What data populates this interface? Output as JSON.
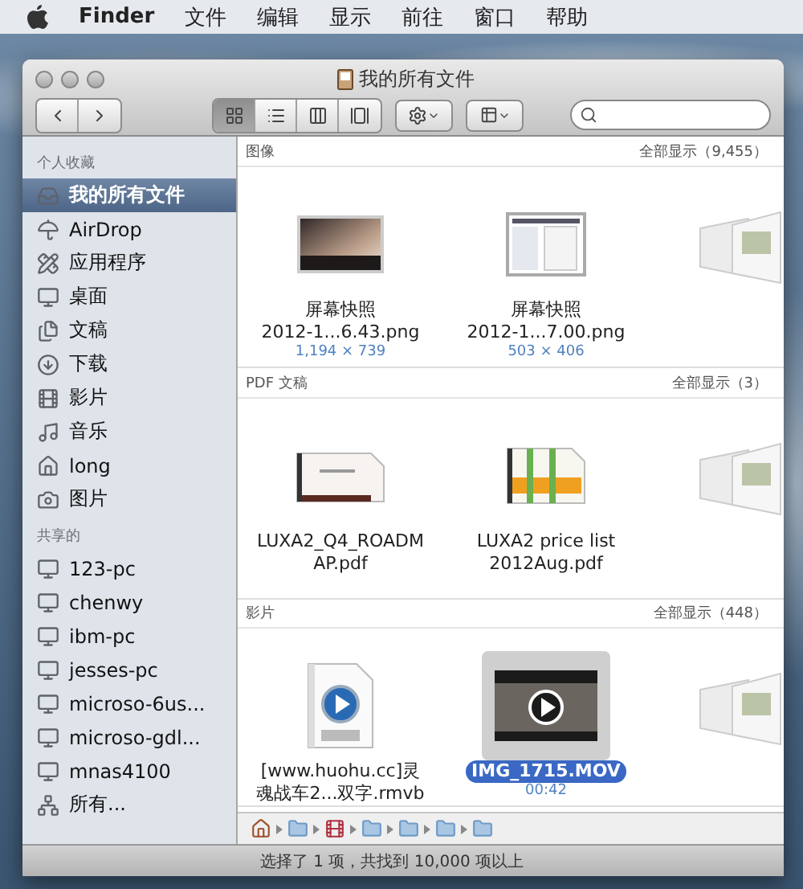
{
  "menubar": {
    "app": "Finder",
    "menus": [
      "文件",
      "编辑",
      "显示",
      "前往",
      "窗口",
      "帮助"
    ]
  },
  "window": {
    "title": "我的所有文件"
  },
  "toolbar": {
    "views": [
      {
        "kind": "icon",
        "selected": true
      },
      {
        "kind": "list",
        "selected": false
      },
      {
        "kind": "column",
        "selected": false
      },
      {
        "kind": "coverflow",
        "selected": false
      }
    ]
  },
  "sidebar": [
    {
      "title": "个人收藏",
      "items": [
        {
          "label": "我的所有文件",
          "kind": "all-files",
          "selected": true
        },
        {
          "label": "AirDrop",
          "kind": "airdrop",
          "selected": false
        },
        {
          "label": "应用程序",
          "kind": "apps",
          "selected": false
        },
        {
          "label": "桌面",
          "kind": "desktop",
          "selected": false
        },
        {
          "label": "文稿",
          "kind": "documents",
          "selected": false
        },
        {
          "label": "下载",
          "kind": "downloads",
          "selected": false
        },
        {
          "label": "影片",
          "kind": "movies",
          "selected": false
        },
        {
          "label": "音乐",
          "kind": "music",
          "selected": false
        },
        {
          "label": "long",
          "kind": "home",
          "selected": false
        },
        {
          "label": "图片",
          "kind": "pictures",
          "selected": false
        }
      ]
    },
    {
      "title": "共享的",
      "items": [
        {
          "label": "123-pc",
          "kind": "computer",
          "selected": false
        },
        {
          "label": "chenwy",
          "kind": "computer",
          "selected": false
        },
        {
          "label": "ibm-pc",
          "kind": "computer",
          "selected": false
        },
        {
          "label": "jesses-pc",
          "kind": "computer",
          "selected": false
        },
        {
          "label": "microso-6us...",
          "kind": "computer",
          "selected": false
        },
        {
          "label": "microso-gdl...",
          "kind": "computer",
          "selected": false
        },
        {
          "label": "mnas4100",
          "kind": "computer",
          "selected": false
        },
        {
          "label": "所有...",
          "kind": "network",
          "selected": false
        }
      ]
    }
  ],
  "sections": [
    {
      "title": "图像",
      "show_all": "全部显示（9,455）",
      "items": [
        {
          "kind": "photo",
          "name_lines": [
            "屏幕快照",
            "2012-1...6.43.png"
          ],
          "detail": "1,194 × 739",
          "selected": false
        },
        {
          "kind": "screenshot",
          "name_lines": [
            "屏幕快照",
            "2012-1...7.00.png"
          ],
          "detail": "503 × 406",
          "selected": false
        },
        {
          "kind": "stack"
        }
      ]
    },
    {
      "title": "PDF 文稿",
      "show_all": "全部显示（3）",
      "items": [
        {
          "kind": "pdf",
          "name_lines": [
            "LUXA2_Q4_ROADM",
            "AP.pdf"
          ],
          "selected": false
        },
        {
          "kind": "pdf-chart",
          "name_lines": [
            "LUXA2 price list",
            "2012Aug.pdf"
          ],
          "selected": false
        },
        {
          "kind": "stack"
        }
      ]
    },
    {
      "title": "影片",
      "show_all": "全部显示（448）",
      "items": [
        {
          "kind": "video-file",
          "name_lines": [
            "[www.huohu.cc]灵",
            "魂战车2...双字.rmvb"
          ],
          "selected": false
        },
        {
          "kind": "movie",
          "name_lines": [
            "IMG_1715.MOV"
          ],
          "detail": "00:42",
          "selected": true
        },
        {
          "kind": "stack"
        }
      ]
    }
  ],
  "path_bar": [
    {
      "kind": "home"
    },
    {
      "kind": "folder"
    },
    {
      "kind": "movie"
    },
    {
      "kind": "folder"
    },
    {
      "kind": "folder"
    },
    {
      "kind": "folder"
    },
    {
      "kind": "folder"
    }
  ],
  "status": "选择了 1 项，共找到 10,000 项以上"
}
